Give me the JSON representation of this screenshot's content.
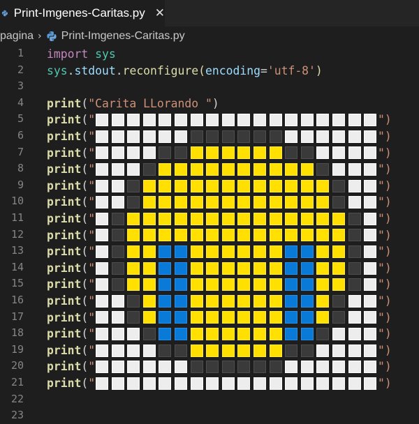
{
  "tab": {
    "title": "Print-Imgenes-Caritas.py",
    "close_glyph": "✕",
    "icon": "python-file-icon"
  },
  "breadcrumb": {
    "folder": "pagina",
    "separator": "›",
    "file": "Print-Imgenes-Caritas.py"
  },
  "colors": {
    "W": "#ededed",
    "K": "#3a3a3a",
    "Y": "#ffe000",
    "B": "#0a7ad8",
    "W_border": "#ffffff",
    "K_border": "#4e4e4e",
    "Y_border": "#ffec40",
    "B_border": "#2a8de6"
  },
  "code": {
    "line2_import": "import",
    "line2_module": "sys",
    "line3_sys": "sys",
    "line3_dot1": ".",
    "line3_stdout": "stdout",
    "line3_dot2": ".",
    "line3_method": "reconfigure",
    "line3_open": "(",
    "line3_param": "encoding",
    "line3_eq": "=",
    "line3_value": "'utf-8'",
    "line3_close": ")",
    "print_kw": "print",
    "print_open": "(",
    "title_string": "\"Carita LLorando \"",
    "print_close": ")",
    "quote": "\"",
    "row_tail": "\")"
  },
  "line_numbers": [
    "1",
    "2",
    "3",
    "4",
    "5",
    "6",
    "7",
    "8",
    "9",
    "10",
    "11",
    "12",
    "13",
    "14",
    "15",
    "16",
    "17",
    "18",
    "19",
    "20",
    "21",
    "22",
    "23"
  ],
  "pixel_rows": [
    "WWWWWWWWWWWWWWWWWW",
    "WWWWWWKKKKKKWWWWWW",
    "WWWWKKYYYYYYKKWWWW",
    "WWWKYYYYYYYYYYKWWW",
    "WWKYYYYYYYYYYYYKWW",
    "WWKYYYYYYYYYYYYKWW",
    "WKYYYYYYYYYYYYYYKW",
    "WKYYYYYYYYYYYYYYKW",
    "WKYYBBYYYYYYBBYYKW",
    "WKYYBBYYYYYYBBYYKW",
    "WKYYBBYYYYYYBBYYKW",
    "WWKYBBYYYYYYBBYKWW",
    "WWKYBBYYYYYYBBYKWW",
    "WWWKBBYYYYYYBBKWWW",
    "WWWWKKYYYYYYKKWWWW",
    "WWWWWWKKKKKKWWWWWW",
    "WWWWWWWWWWWWWWWWWW"
  ]
}
